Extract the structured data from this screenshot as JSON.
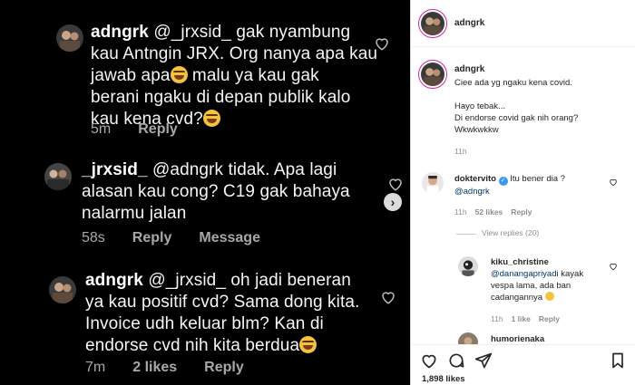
{
  "story": {
    "comments": [
      {
        "user": "adngrk",
        "text_lines": [
          "@_jrxsid_ gak nyambung",
          "kau Antngin JRX. Org nanya apa kau",
          "jawab apa",
          " malu ya kau gak",
          "berani ngaku di depan publik kalo",
          "kau kena cvd?"
        ],
        "meta": {
          "time": "5m",
          "reply": "Reply"
        }
      },
      {
        "user": "_jrxsid_",
        "text_lines": [
          "@adngrk tidak. Apa lagi",
          "alasan kau cong? C19 gak bahaya",
          "nalarmu jalan"
        ],
        "meta": {
          "time": "58s",
          "reply": "Reply",
          "message": "Message"
        }
      },
      {
        "user": "adngrk",
        "text_lines": [
          "@_jrxsid_ oh jadi beneran",
          "ya kau positif cvd? Sama dong kita.",
          "Invoice udh keluar blm? Kan di",
          "endorse cvd nih kita berdua"
        ],
        "meta": {
          "time": "7m",
          "likes": "2 likes",
          "reply": "Reply"
        }
      }
    ],
    "next_icon": "chevron-right-icon"
  },
  "post": {
    "header_user": "adngrk",
    "caption": {
      "user": "adngrk",
      "lines": [
        "Ciee ada yg ngaku kena covid.",
        "",
        "Hayo tebak...",
        "Di endorse covid gak nih orang?",
        "Wkwkwkkw"
      ],
      "time": "11h"
    },
    "comment1": {
      "user": "doktervito",
      "text": " Itu bener dia ?",
      "mention": "@adngrk",
      "time": "11h",
      "likes": "52 likes",
      "reply": "Reply"
    },
    "view_replies": "View replies (20)",
    "reply1": {
      "user": "kiku_christine",
      "mention": "@danangapriyadi",
      "text_a": " kayak",
      "line2": "vespa lama, ada ban",
      "line3": "cadangannya ",
      "time": "11h",
      "likes": "1 like",
      "reply": "Reply"
    },
    "reply2_user": "humorienaka",
    "likes_total": "1,898 likes",
    "colors": {
      "accent": "#3897f0",
      "mention": "#00376b",
      "ring": "#d6249f"
    }
  }
}
